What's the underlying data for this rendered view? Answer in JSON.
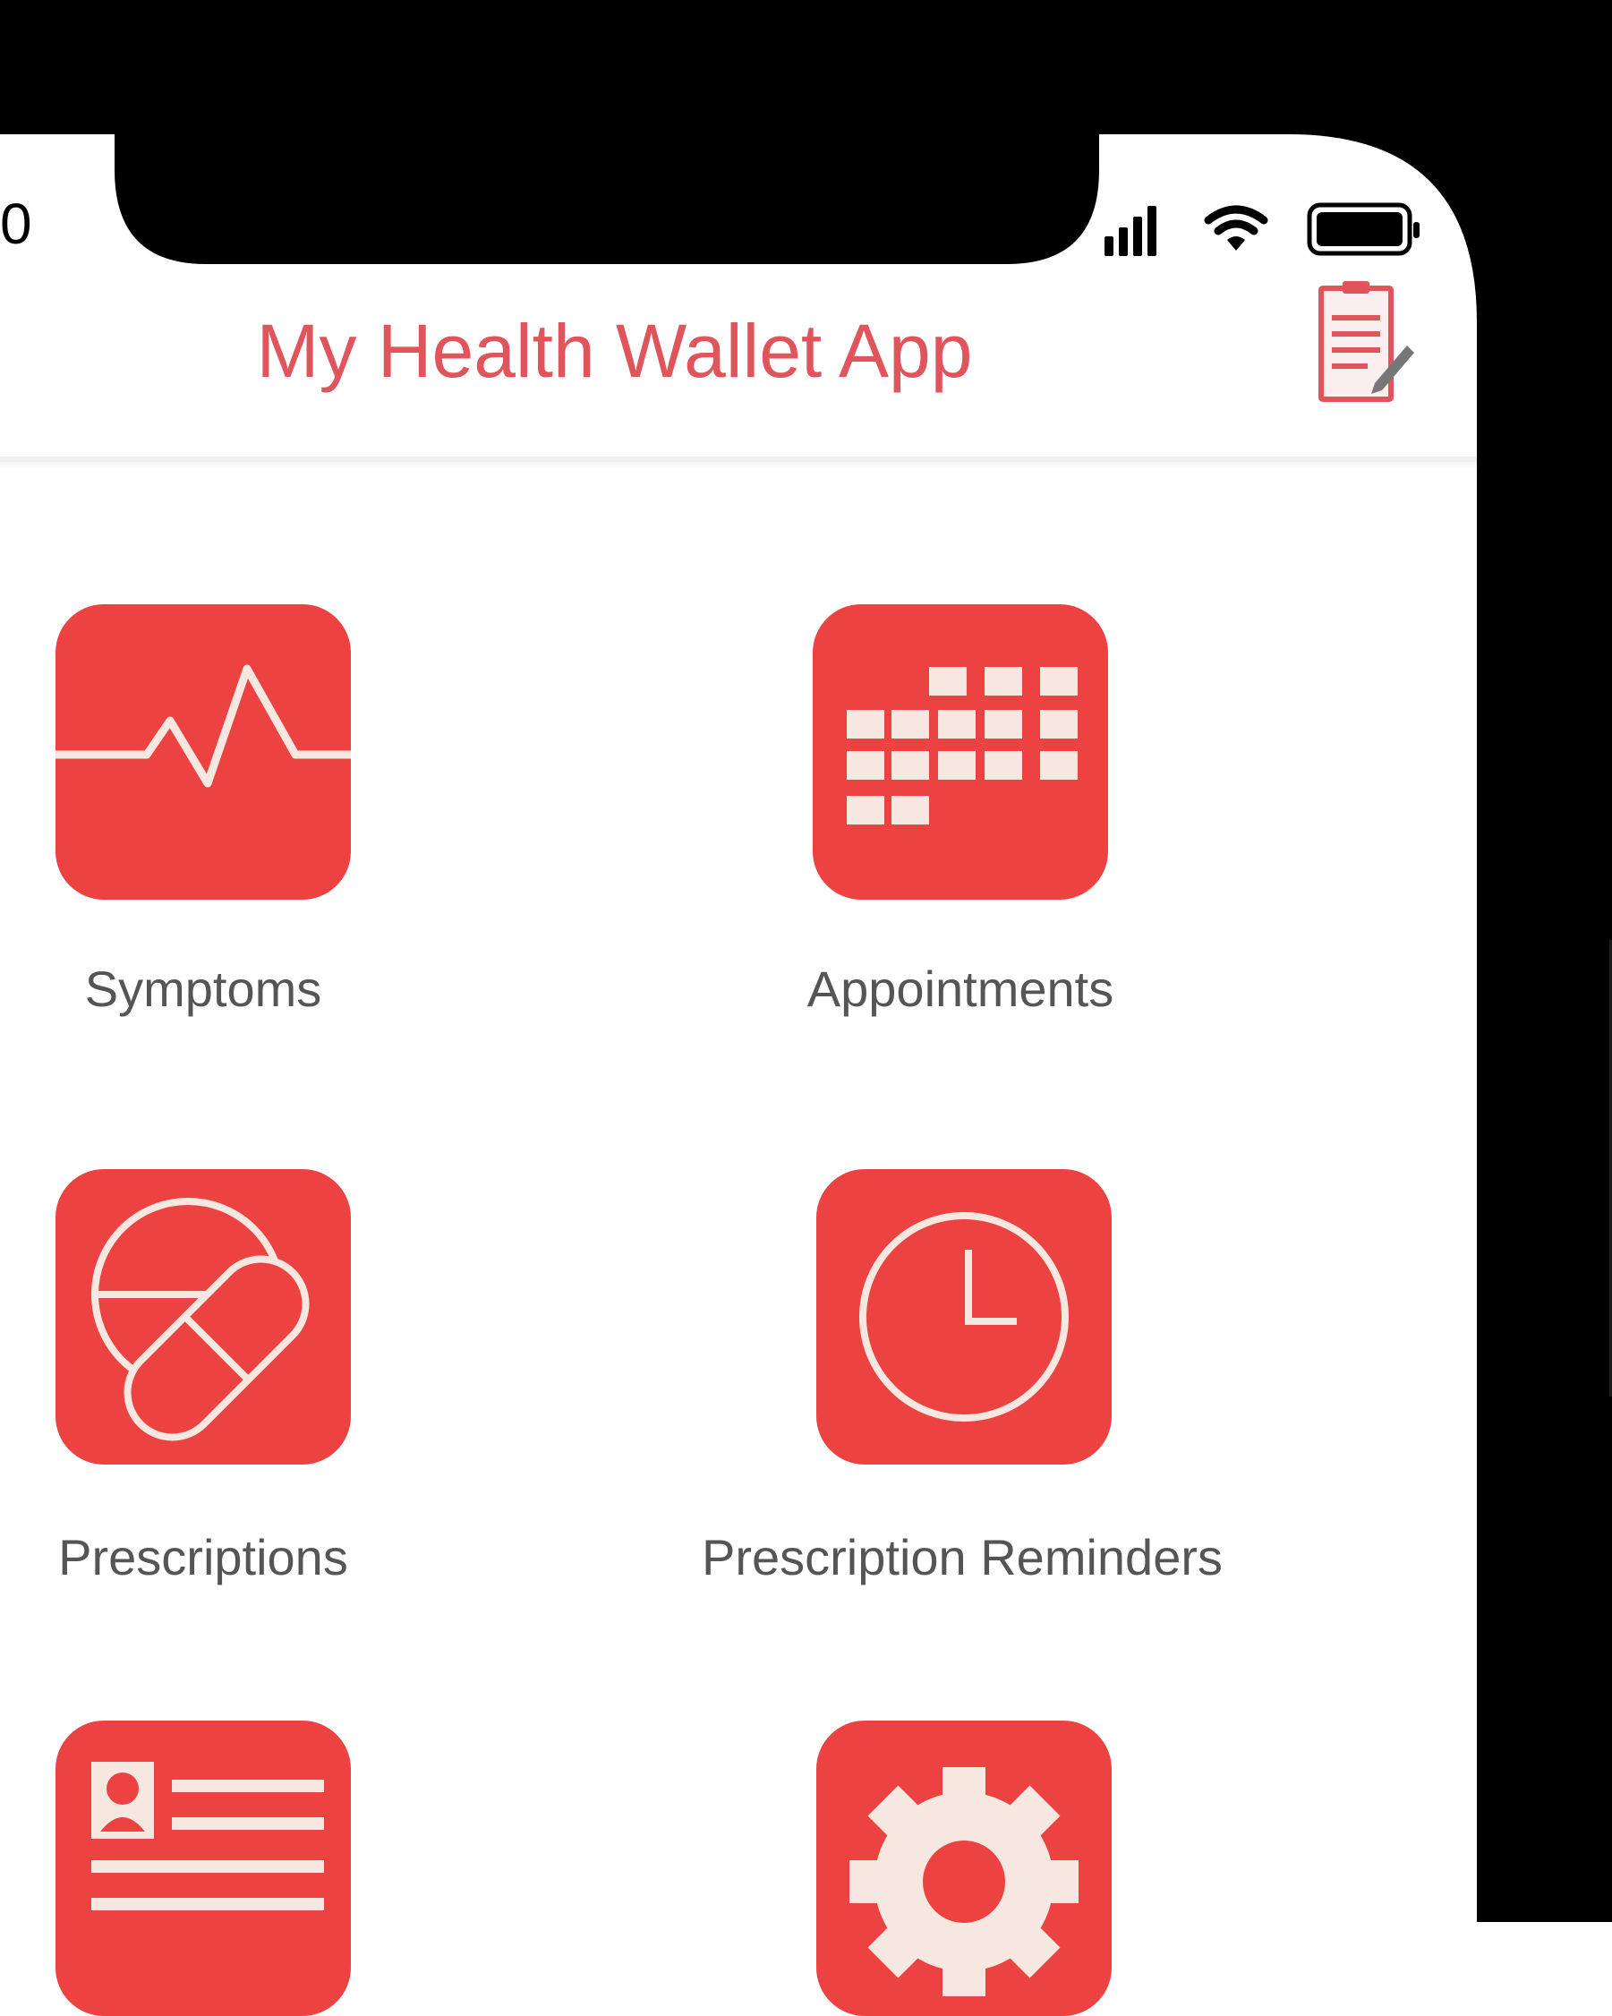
{
  "status_bar": {
    "time": "0",
    "icons": [
      "cellular-signal-icon",
      "wifi-icon",
      "battery-icon"
    ]
  },
  "nav": {
    "title": "My Health Wallet App",
    "title_color": "#e0545b",
    "right_icon": "clipboard-edit-icon"
  },
  "menu": {
    "tile_color": "#ec4241",
    "items": [
      {
        "label": "Symptoms",
        "icon": "heartbeat-icon"
      },
      {
        "label": "Appointments",
        "icon": "calendar-grid-icon"
      },
      {
        "label": "Prescriptions",
        "icon": "pills-icon"
      },
      {
        "label": "Prescription Reminders",
        "icon": "clock-icon"
      },
      {
        "label": "",
        "icon": "id-card-icon"
      },
      {
        "label": "",
        "icon": "gear-icon"
      }
    ]
  }
}
